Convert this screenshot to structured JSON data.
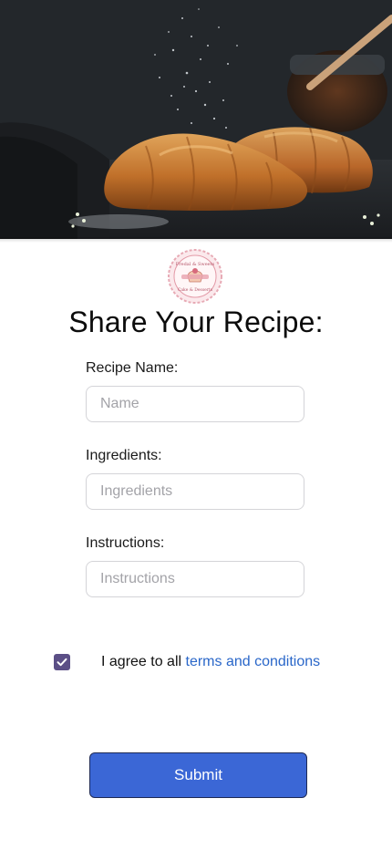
{
  "hero": {
    "image_name": "croissants-photo",
    "accent_dark": "#1b1e21",
    "pastry_color": "#c67a2e"
  },
  "logo": {
    "icon": "bakery-logo-badge",
    "top_text": "Fredal & Sweets",
    "bottom_text": "Cake & Desserts",
    "color": "#e7aab5"
  },
  "page": {
    "title": "Share Your Recipe:"
  },
  "form": {
    "recipe_name": {
      "label": "Recipe Name:",
      "placeholder": "Name",
      "value": ""
    },
    "ingredients": {
      "label": "Ingredients:",
      "placeholder": "Ingredients",
      "value": ""
    },
    "instructions": {
      "label": "Instructions:",
      "placeholder": "Instructions",
      "value": ""
    },
    "agree": {
      "checked": true,
      "text": "I agree to all ",
      "link_text": "terms and conditions",
      "check_color": "#5b4f86",
      "link_color": "#2a67c9"
    },
    "submit_label": "Submit",
    "submit_color": "#3b67d6"
  }
}
